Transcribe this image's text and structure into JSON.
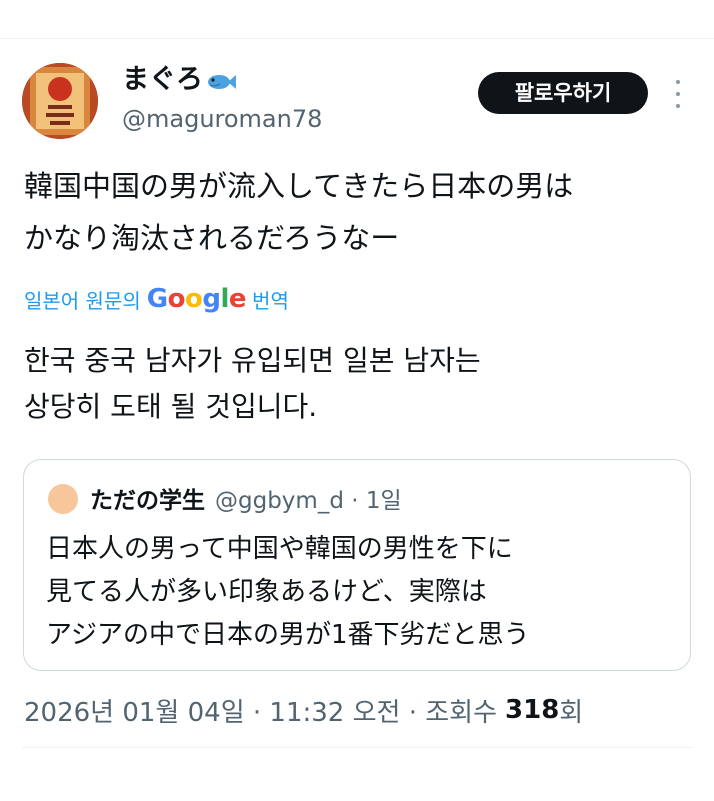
{
  "tweet": {
    "author": {
      "display_name": "まぐろ",
      "handle": "@maguroman78",
      "emoji_icon": "fish-icon"
    },
    "follow_button_label": "팔로우하기",
    "text": "韓国中国の男が流入してきたら日本の男は\nかなり淘汰されるだろうなー",
    "translation": {
      "prefix": "일본어 원문의",
      "provider": "Google",
      "suffix": "번역",
      "text": "한국 중국 남자가 유입되면 일본 남자는\n상당히 도태 될 것입니다."
    },
    "quoted_tweet": {
      "author_name": "ただの学生",
      "handle_and_time": "@ggbym_d · 1일",
      "text": "日本人の男って中国や韓国の男性を下に\n見てる人が多い印象あるけど、実際は\nアジアの中で日本の男が1番下劣だと思う"
    },
    "meta": {
      "timestamp": "2026년 01월 04일 · 11:32 오전 · 조회수",
      "views": "318",
      "views_unit": "회"
    }
  },
  "colors": {
    "text_primary": "#0f1419",
    "text_secondary": "#536471",
    "link": "#1d9bf0",
    "button_bg": "#0f1419",
    "border": "#cfd9de"
  }
}
